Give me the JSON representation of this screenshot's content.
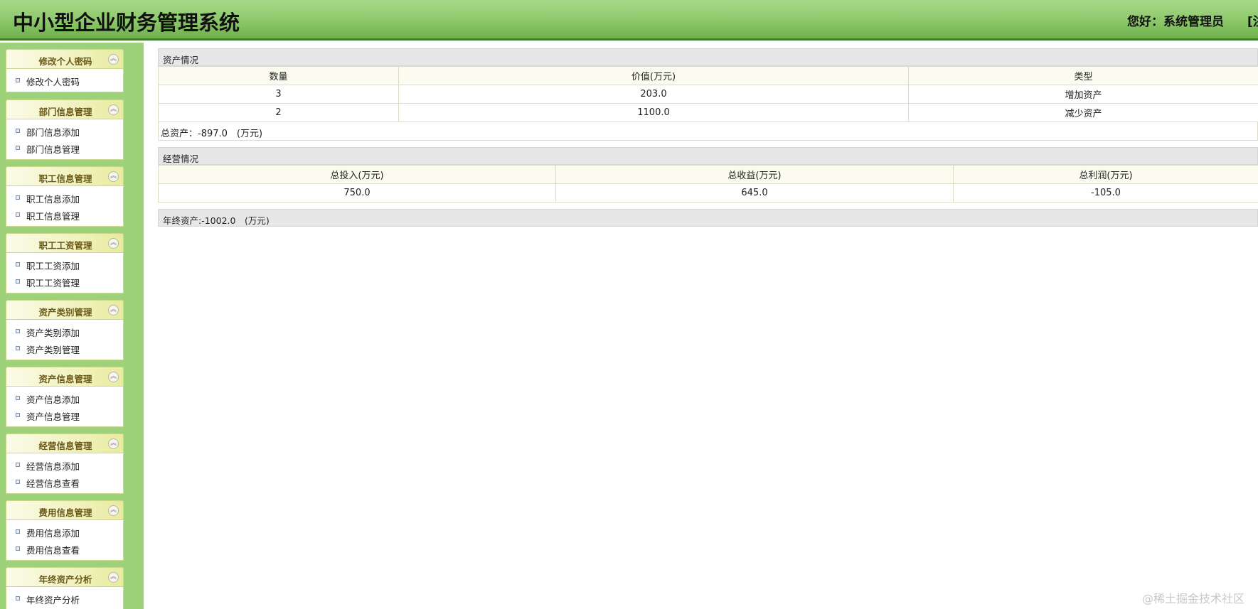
{
  "header": {
    "title": "中小型企业财务管理系统",
    "greeting": "您好：系统管理员",
    "extra": "[注"
  },
  "sidebar": {
    "groups": [
      {
        "title": "修改个人密码",
        "items": [
          "修改个人密码"
        ]
      },
      {
        "title": "部门信息管理",
        "items": [
          "部门信息添加",
          "部门信息管理"
        ]
      },
      {
        "title": "职工信息管理",
        "items": [
          "职工信息添加",
          "职工信息管理"
        ]
      },
      {
        "title": "职工工资管理",
        "items": [
          "职工工资添加",
          "职工工资管理"
        ]
      },
      {
        "title": "资产类别管理",
        "items": [
          "资产类别添加",
          "资产类别管理"
        ]
      },
      {
        "title": "资产信息管理",
        "items": [
          "资产信息添加",
          "资产信息管理"
        ]
      },
      {
        "title": "经营信息管理",
        "items": [
          "经营信息添加",
          "经营信息查看"
        ]
      },
      {
        "title": "费用信息管理",
        "items": [
          "费用信息添加",
          "费用信息查看"
        ]
      },
      {
        "title": "年终资产分析",
        "items": [
          "年终资产分析"
        ]
      }
    ]
  },
  "assets": {
    "section_title": "资产情况",
    "columns": [
      "数量",
      "价值(万元)",
      "类型"
    ],
    "rows": [
      [
        "3",
        "203.0",
        "增加资产"
      ],
      [
        "2",
        "1100.0",
        "减少资产"
      ]
    ],
    "total": "总资产：-897.0　(万元)"
  },
  "operations": {
    "section_title": "经营情况",
    "columns": [
      "总投入(万元)",
      "总收益(万元)",
      "总利润(万元)"
    ],
    "rows": [
      [
        "750.0",
        "645.0",
        "-105.0"
      ]
    ]
  },
  "year_end": "年终资产:-1002.0　(万元)",
  "watermark": "@稀土掘金技术社区",
  "colors": {
    "header_green": "#8cc86a",
    "sidebar_green": "#9dd27a",
    "section_gray": "#e7e7e7"
  }
}
